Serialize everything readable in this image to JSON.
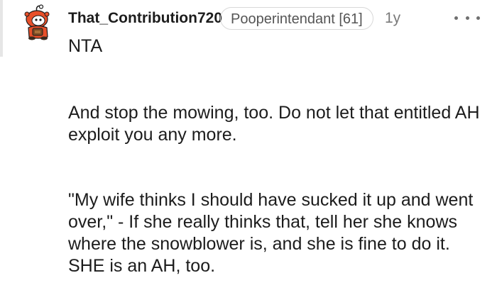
{
  "comment": {
    "author": "That_Contribution720",
    "flair": "Pooperintendant [61]",
    "age": "1y",
    "more_icon": "more-horizontal-icon",
    "avatar_icon": "snoo-avatar-icon",
    "paragraphs": [
      "NTA",
      "And stop the mowing, too. Do not let that entitled AH exploit you any more.",
      "\"My wife thinks I should have sucked it up and went over,\" - If she really thinks that, tell her she knows where the snowblower is, and she is fine to do it. SHE is an AH, too."
    ]
  },
  "colors": {
    "text": "#1c1c1c",
    "muted": "#7a7a7a",
    "avatar_orange": "#e8502a"
  }
}
